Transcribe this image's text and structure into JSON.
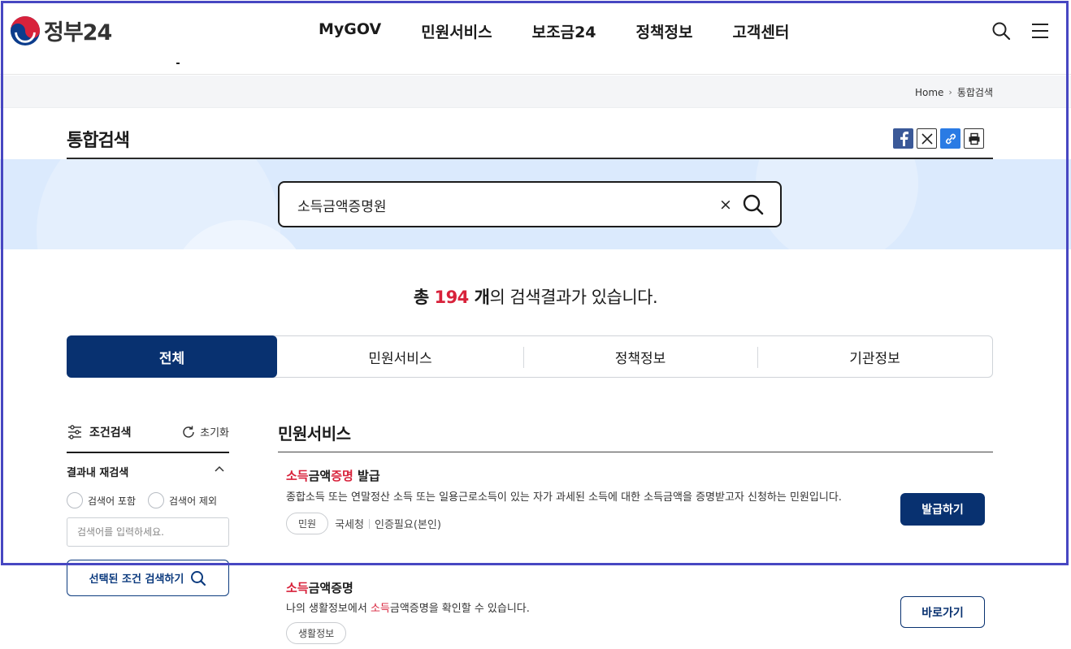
{
  "header": {
    "logo_text": "정부24",
    "nav": [
      "MyGOV",
      "민원서비스",
      "보조금24",
      "정책정보",
      "고객센터"
    ],
    "icons": [
      "search-icon",
      "menu-icon"
    ]
  },
  "breadcrumb": {
    "home": "Home",
    "current": "통합검색"
  },
  "page": {
    "title": "통합검색",
    "share_icons": [
      "facebook-icon",
      "x-twitter-icon",
      "link-icon",
      "print-icon"
    ]
  },
  "search": {
    "value": "소득금액증명원",
    "clear_label": "×"
  },
  "results": {
    "prefix": "총 ",
    "count": "194",
    "unit": " 개",
    "suffix": "의 검색결과가 있습니다."
  },
  "tabs": [
    {
      "label": "전체",
      "active": true
    },
    {
      "label": "민원서비스",
      "active": false
    },
    {
      "label": "정책정보",
      "active": false
    },
    {
      "label": "기관정보",
      "active": false
    }
  ],
  "filter": {
    "title": "조건검색",
    "reset": "초기화",
    "refine_title": "결과내 재검색",
    "include_label": "검색어 포함",
    "exclude_label": "검색어 제외",
    "input_placeholder": "검색어를 입력하세요.",
    "apply_label": "선택된 조건 검색하기"
  },
  "section": {
    "title": "민원서비스"
  },
  "items": [
    {
      "title_hl1": "소득",
      "title_mid": "금액",
      "title_hl2": "증명",
      "title_rest": " 발급",
      "desc": "종합소득 또는 연말정산 소득 또는 일용근로소득이 있는 자가 과세된 소득에 대한 소득금액을 증명받고자 신청하는 민원입니다.",
      "tag": "민원",
      "agency": "국세청",
      "auth": "인증필요(본인)",
      "button": "발급하기"
    },
    {
      "title_hl1": "소득",
      "title_rest": "금액증명",
      "desc_pre": "나의 생활정보에서 ",
      "desc_hl": "소득",
      "desc_post": "금액증명을 확인할 수 있습니다.",
      "tag": "생활정보",
      "button": "바로가기"
    }
  ],
  "colors": {
    "primary": "#083170",
    "highlight": "#d8223b",
    "band": "#dbeafd",
    "frame": "#4747c2"
  }
}
